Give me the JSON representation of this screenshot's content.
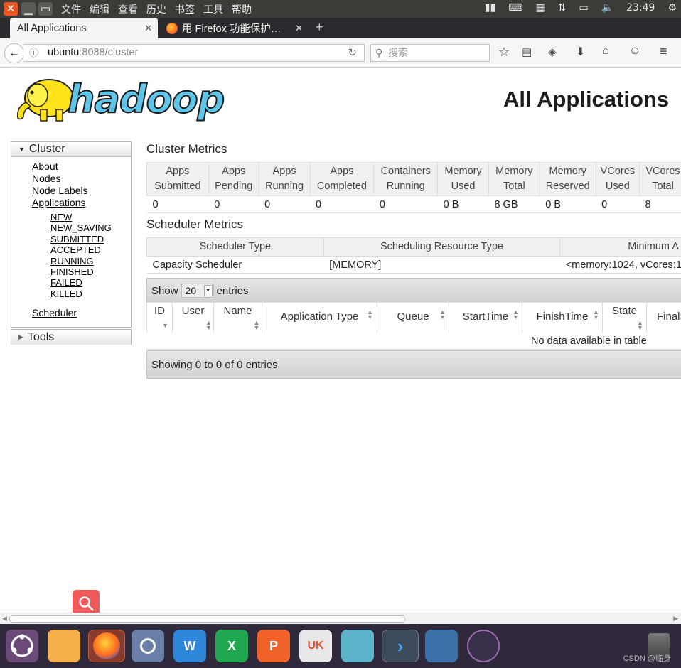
{
  "os": {
    "menus": [
      "文件",
      "编辑",
      "查看",
      "历史",
      "书签",
      "工具",
      "帮助"
    ],
    "clock": "23:49",
    "dock_labels": {
      "word": "W",
      "excel": "X",
      "ppt": "P",
      "store": "UK"
    },
    "watermark": "CSDN @临身"
  },
  "browser": {
    "tabs": [
      {
        "label": "All Applications",
        "active": true
      },
      {
        "label": "用 Firefox 功能保护…",
        "active": false
      }
    ],
    "url_host": "ubuntu",
    "url_rest": ":8088/cluster",
    "search_placeholder": "搜索"
  },
  "page": {
    "title": "All Applications",
    "logo_text": "hadoop",
    "sidebar": {
      "cluster_header": "Cluster",
      "links": [
        "About",
        "Nodes",
        "Node Labels",
        "Applications"
      ],
      "app_states": [
        "NEW",
        "NEW_SAVING",
        "SUBMITTED",
        "ACCEPTED",
        "RUNNING",
        "FINISHED",
        "FAILED",
        "KILLED"
      ],
      "scheduler": "Scheduler",
      "tools_header": "Tools"
    },
    "cluster_metrics": {
      "title": "Cluster Metrics",
      "headers": [
        [
          "Apps",
          "Submitted"
        ],
        [
          "Apps",
          "Pending"
        ],
        [
          "Apps",
          "Running"
        ],
        [
          "Apps",
          "Completed"
        ],
        [
          "Containers",
          "Running"
        ],
        [
          "Memory",
          "Used"
        ],
        [
          "Memory",
          "Total"
        ],
        [
          "Memory",
          "Reserved"
        ],
        [
          "VCores",
          "Used"
        ],
        [
          "VCores",
          "Total"
        ]
      ],
      "values": [
        "0",
        "0",
        "0",
        "0",
        "0",
        "0 B",
        "8 GB",
        "0 B",
        "0",
        "8"
      ]
    },
    "scheduler_metrics": {
      "title": "Scheduler Metrics",
      "headers": [
        "Scheduler Type",
        "Scheduling Resource Type",
        "Minimum A"
      ],
      "values": [
        "Capacity Scheduler",
        "[MEMORY]",
        "<memory:1024, vCores:1"
      ]
    },
    "apps_table": {
      "show_label": "Show",
      "entries_value": "20",
      "entries_label": "entries",
      "columns": [
        "ID",
        "User",
        "Name",
        "Application Type",
        "Queue",
        "StartTime",
        "FinishTime",
        "State",
        "FinalS"
      ],
      "empty_text": "No data available in table",
      "info_text": "Showing 0 to 0 of 0 entries"
    }
  }
}
